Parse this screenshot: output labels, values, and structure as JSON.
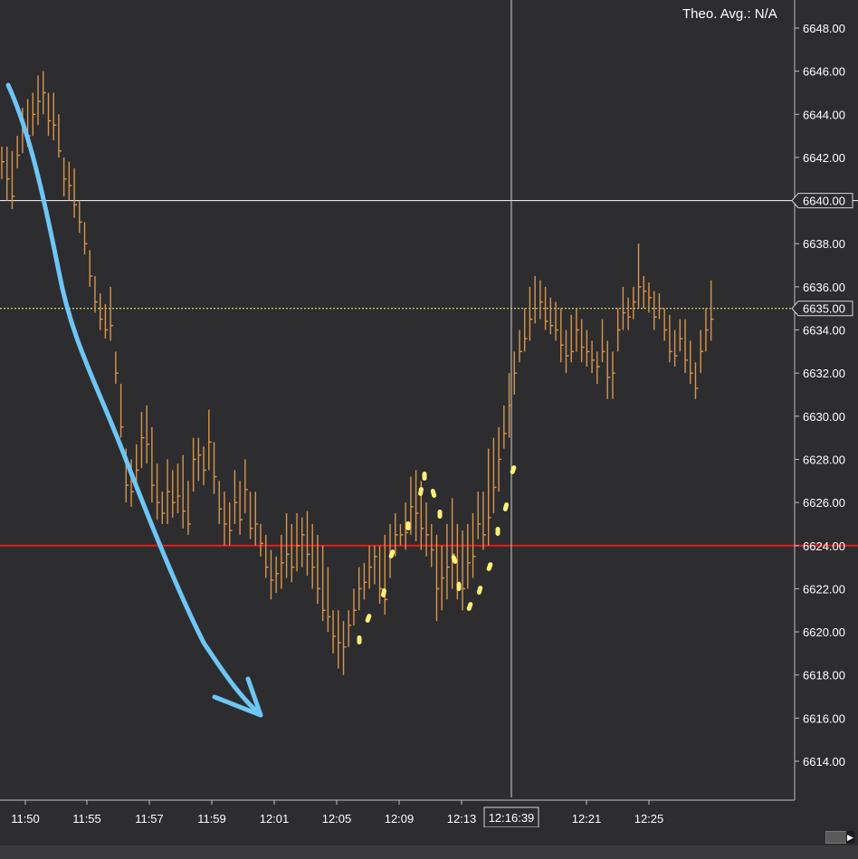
{
  "header": {
    "theo_label": "Theo. Avg.: N/A"
  },
  "colors": {
    "background": "#2d2d30",
    "bar": "#d9954a",
    "grid_line": "#ffffff",
    "support_line": "#e01e1e",
    "dotted_line": "#ffff66",
    "arrow": "#6ec6f5",
    "highlight": "#fff27a"
  },
  "cursor": {
    "time_label": "12:16:39"
  },
  "price_markers": {
    "crosshair_price": "6640.00",
    "dotted_price": "6635.00"
  },
  "chart_data": {
    "type": "bar",
    "subtype": "ohlc",
    "y_ticks": [
      "6648.00",
      "6646.00",
      "6644.00",
      "6642.00",
      "6640.00",
      "6638.00",
      "6636.00",
      "6634.00",
      "6632.00",
      "6630.00",
      "6628.00",
      "6626.00",
      "6624.00",
      "6622.00",
      "6620.00",
      "6618.00",
      "6616.00",
      "6614.00"
    ],
    "x_ticks": [
      "11:50",
      "11:55",
      "11:57",
      "11:59",
      "12:01",
      "12:05",
      "12:09",
      "12:13",
      "12:21",
      "12:25"
    ],
    "ylim": [
      6612.4,
      6649.4
    ],
    "horizontal_lines": [
      {
        "price": 6640.0,
        "style": "solid",
        "color": "#ffffff"
      },
      {
        "price": 6635.0,
        "style": "dotted",
        "color": "#ffff66"
      },
      {
        "price": 6624.0,
        "style": "solid",
        "color": "#e01e1e"
      }
    ],
    "bars": [
      [
        6642.5,
        6641.0,
        6641.8
      ],
      [
        6642.5,
        6640.0,
        6641.0
      ],
      [
        6642.3,
        6639.6,
        6640.2
      ],
      [
        6643.0,
        6641.5,
        6642.1
      ],
      [
        6644.3,
        6642.2,
        6643.5
      ],
      [
        6644.7,
        6642.5,
        6643.0
      ],
      [
        6645.0,
        6643.0,
        6644.0
      ],
      [
        6645.8,
        6643.5,
        6644.6
      ],
      [
        6646.0,
        6644.0,
        6645.0
      ],
      [
        6645.0,
        6643.0,
        6643.7
      ],
      [
        6645.0,
        6642.8,
        6643.5
      ],
      [
        6644.0,
        6642.0,
        6642.3
      ],
      [
        6642.0,
        6640.2,
        6641.0
      ],
      [
        6641.8,
        6640.0,
        6640.7
      ],
      [
        6641.5,
        6639.2,
        6639.8
      ],
      [
        6640.0,
        6638.5,
        6639.0
      ],
      [
        6639.0,
        6637.5,
        6638.0
      ],
      [
        6637.7,
        6636.0,
        6636.5
      ],
      [
        6636.5,
        6634.8,
        6635.3
      ],
      [
        6635.7,
        6634.0,
        6634.5
      ],
      [
        6635.2,
        6633.6,
        6634.0
      ],
      [
        6636.0,
        6633.5,
        6634.2
      ],
      [
        6633.0,
        6631.5,
        6632.0
      ],
      [
        6631.5,
        6629.0,
        6629.5
      ],
      [
        6628.5,
        6626.0,
        6626.8
      ],
      [
        6628.0,
        6625.8,
        6626.5
      ],
      [
        6628.7,
        6626.6,
        6627.5
      ],
      [
        6630.2,
        6627.6,
        6629.0
      ],
      [
        6630.5,
        6627.8,
        6628.7
      ],
      [
        6629.5,
        6626.0,
        6626.8
      ],
      [
        6627.8,
        6625.2,
        6626.0
      ],
      [
        6626.5,
        6625.0,
        6625.5
      ],
      [
        6628.0,
        6625.0,
        6626.5
      ],
      [
        6627.5,
        6625.3,
        6626.0
      ],
      [
        6627.8,
        6625.5,
        6626.3
      ],
      [
        6628.2,
        6624.8,
        6625.6
      ],
      [
        6627.0,
        6624.5,
        6625.0
      ],
      [
        6629.0,
        6626.5,
        6628.0
      ],
      [
        6629.0,
        6627.0,
        6628.2
      ],
      [
        6628.6,
        6626.8,
        6627.5
      ],
      [
        6630.3,
        6627.5,
        6628.8
      ],
      [
        6628.8,
        6626.4,
        6627.2
      ],
      [
        6627.0,
        6625.0,
        6625.7
      ],
      [
        6626.5,
        6624.0,
        6625.0
      ],
      [
        6626.0,
        6624.0,
        6624.7
      ],
      [
        6627.5,
        6625.0,
        6626.0
      ],
      [
        6627.0,
        6624.5,
        6625.2
      ],
      [
        6628.0,
        6625.5,
        6626.6
      ],
      [
        6626.5,
        6624.3,
        6624.8
      ],
      [
        6626.5,
        6624.0,
        6625.0
      ],
      [
        6625.0,
        6623.5,
        6624.1
      ],
      [
        6624.5,
        6622.5,
        6623.0
      ],
      [
        6623.8,
        6621.5,
        6622.4
      ],
      [
        6623.5,
        6621.8,
        6622.7
      ],
      [
        6624.5,
        6622.0,
        6623.2
      ],
      [
        6625.5,
        6622.5,
        6623.6
      ],
      [
        6625.0,
        6622.3,
        6623.0
      ],
      [
        6625.5,
        6622.8,
        6624.0
      ],
      [
        6625.3,
        6623.0,
        6624.5
      ],
      [
        6625.6,
        6622.6,
        6623.6
      ],
      [
        6625.0,
        6622.0,
        6623.0
      ],
      [
        6624.5,
        6621.3,
        6622.0
      ],
      [
        6624.0,
        6620.5,
        6621.0
      ],
      [
        6623.0,
        6620.0,
        6620.7
      ],
      [
        6621.0,
        6619.0,
        6619.8
      ],
      [
        6621.0,
        6618.3,
        6619.5
      ],
      [
        6620.5,
        6618.0,
        6619.3
      ],
      [
        6621.0,
        6619.3,
        6620.3
      ],
      [
        6622.0,
        6620.3,
        6621.0
      ],
      [
        6623.0,
        6621.0,
        6622.0
      ],
      [
        6623.2,
        6621.5,
        6622.3
      ],
      [
        6624.0,
        6622.0,
        6623.0
      ],
      [
        6624.0,
        6622.2,
        6623.5
      ],
      [
        6624.0,
        6621.3,
        6622.0
      ],
      [
        6624.5,
        6620.8,
        6621.5
      ],
      [
        6625.0,
        6622.5,
        6623.5
      ],
      [
        6625.5,
        6623.5,
        6624.5
      ],
      [
        6625.0,
        6624.0,
        6624.5
      ],
      [
        6626.0,
        6623.8,
        6624.6
      ],
      [
        6627.2,
        6624.5,
        6625.8
      ],
      [
        6627.5,
        6624.2,
        6625.5
      ],
      [
        6627.0,
        6623.8,
        6624.8
      ],
      [
        6626.0,
        6623.5,
        6624.5
      ],
      [
        6625.0,
        6623.0,
        6623.8
      ],
      [
        6624.5,
        6620.5,
        6622.0
      ],
      [
        6624.0,
        6621.0,
        6622.5
      ],
      [
        6625.0,
        6621.5,
        6623.0
      ],
      [
        6626.2,
        6622.0,
        6623.6
      ],
      [
        6625.0,
        6621.5,
        6622.3
      ],
      [
        6624.7,
        6621.0,
        6622.0
      ],
      [
        6625.0,
        6622.0,
        6623.2
      ],
      [
        6625.5,
        6622.5,
        6623.5
      ],
      [
        6626.5,
        6624.3,
        6625.0
      ],
      [
        6626.5,
        6623.8,
        6624.5
      ],
      [
        6628.5,
        6624.0,
        6625.3
      ],
      [
        6629.0,
        6625.5,
        6626.7
      ],
      [
        6629.5,
        6626.5,
        6628.0
      ],
      [
        6630.5,
        6628.5,
        6629.2
      ],
      [
        6632.0,
        6629.0,
        6630.5
      ],
      [
        6633.0,
        6631.0,
        6632.0
      ],
      [
        6634.0,
        6632.5,
        6633.0
      ],
      [
        6635.0,
        6633.0,
        6633.6
      ],
      [
        6636.0,
        6633.5,
        6634.5
      ],
      [
        6636.5,
        6634.3,
        6635.0
      ],
      [
        6636.3,
        6634.5,
        6635.3
      ],
      [
        6636.0,
        6634.0,
        6634.4
      ],
      [
        6635.5,
        6633.8,
        6634.2
      ],
      [
        6635.3,
        6633.5,
        6634.0
      ],
      [
        6635.0,
        6632.5,
        6633.3
      ],
      [
        6634.0,
        6632.0,
        6632.8
      ],
      [
        6634.7,
        6632.5,
        6633.0
      ],
      [
        6635.0,
        6633.0,
        6634.0
      ],
      [
        6634.5,
        6632.5,
        6633.2
      ],
      [
        6634.0,
        6632.3,
        6633.0
      ],
      [
        6633.5,
        6632.0,
        6632.6
      ],
      [
        6633.0,
        6631.5,
        6632.3
      ],
      [
        6634.5,
        6632.5,
        6633.0
      ],
      [
        6633.5,
        6630.8,
        6631.8
      ],
      [
        6633.0,
        6630.8,
        6632.0
      ],
      [
        6635.0,
        6633.0,
        6634.0
      ],
      [
        6636.0,
        6634.0,
        6634.8
      ],
      [
        6635.5,
        6634.0,
        6634.6
      ],
      [
        6636.0,
        6634.5,
        6635.3
      ],
      [
        6638.0,
        6635.0,
        6636.0
      ],
      [
        6636.5,
        6635.0,
        6635.8
      ],
      [
        6636.2,
        6634.8,
        6635.5
      ],
      [
        6635.8,
        6634.0,
        6634.6
      ],
      [
        6635.7,
        6634.5,
        6635.0
      ],
      [
        6635.0,
        6633.5,
        6634.0
      ],
      [
        6634.7,
        6632.5,
        6633.0
      ],
      [
        6634.0,
        6632.3,
        6632.8
      ],
      [
        6634.5,
        6633.0,
        6633.6
      ],
      [
        6634.5,
        6632.0,
        6632.6
      ],
      [
        6633.5,
        6631.5,
        6632.0
      ],
      [
        6632.5,
        6630.8,
        6631.3
      ],
      [
        6634.0,
        6632.0,
        6633.0
      ],
      [
        6635.0,
        6633.0,
        6634.0
      ],
      [
        6636.3,
        6633.5,
        6634.5
      ]
    ]
  }
}
